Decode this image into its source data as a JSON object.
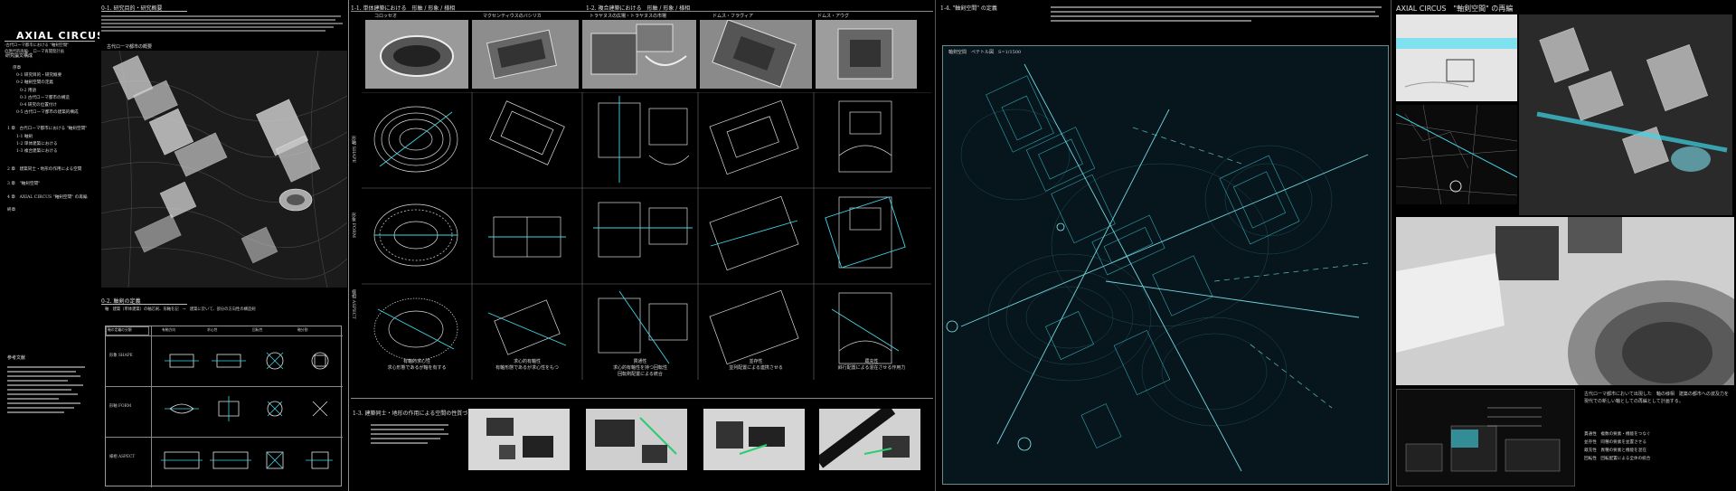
{
  "title": {
    "main": "AXIAL CIRCUS",
    "sub1": "-古代ローマ都市における \"軸剣空間\"",
    "sub2": "の現代的再編-　ローマ再開発計画"
  },
  "toc": {
    "heading": "研究論文構成",
    "items": [
      "序章",
      "0-1 研究目的・研究概要",
      "0-2 軸剣空間の定義",
      "0-2 用語",
      "0-3 古代ローマ都市の構造",
      "0-4 研究の位置付け",
      "0-5 古代ローマ都市の建築的構成",
      "1 章　古代ローマ都市における \"軸剣空間\"",
      "1-1 軸剣",
      "1-2 単体建築における",
      "1-3 複合建築における",
      "2 章　建築同士・地形の作用による空間",
      "3 章　\"軸剣空間\"",
      "4 章　AXIAL CIRCUS \"軸剣空間\" の再編",
      "終章"
    ],
    "refs_heading": "参考文献"
  },
  "sections": {
    "s01": "0-1. 研究目的・研究概要",
    "s01_intro": "古代ローマ都市の概要",
    "s02": "0-2. 軸剣の定義",
    "s02_formula": "軸　建築（単体建築）の軸芯剣、形軸を記　→　建築に於いて、部分の方向性の構造剣",
    "s11": "1-1. 単体建築における　形軸 / 形象 / 様相",
    "s12": "1-2. 複合建築における　形軸 / 形象 / 様相",
    "s13": "1-3. 建築同士・地形の作用による空間の性質づけ",
    "s14": "1-4. \"軸剣空間\" の定義",
    "s4": "AXIAL CIRCUS　\"軸剣空間\" の再編"
  },
  "buildings": [
    "コロッセオ",
    "マクセンティウスのバシリカ",
    "トラヤヌスの広場・トラヤヌスの市場",
    "ドムス・フラヴィア",
    "ドムス・アウグ"
  ],
  "row_labels": [
    "形軸 SHAPE",
    "形象 FORM",
    "様相 ASPECT"
  ],
  "column_captions": [
    [
      "有軸的求心性",
      "求心形態であるが軸を有する"
    ],
    [
      "求心的有軸性",
      "有軸形態であるが求心性をもつ"
    ],
    [
      "貫通性",
      "求心的有軸性を持つ回転性",
      "回転剣配置による統合"
    ],
    [
      "並存性",
      "並列配置による連携させる"
    ],
    [
      "蔵充性",
      "斜行配置による混在させる作用力"
    ]
  ],
  "table": {
    "headers": [
      "軸の定義の分類",
      "有軸方向",
      "求心性",
      "回転性",
      "軸分割"
    ],
    "rows": [
      "形象 SHAPE",
      "形軸 FORM",
      "様相 ASPECT"
    ]
  },
  "plan_title": "軸剣空間　ペテトル図　S=1/1500",
  "right_text": "古代ローマ都市において出現した　軸の様相　建築の都市への波及力を　現代での新しい軸としての再編として計画する。",
  "legend": [
    "貫通性　複数の要素・機能をつなぐ",
    "並存性　同種の要素を並置させる",
    "蔵充性　異種の要素と機能を混在",
    "回転性　回転配置による全体の統合"
  ],
  "colors": {
    "accent": "#3fd6e6",
    "background": "#000000",
    "line": "#cfcfcf"
  }
}
